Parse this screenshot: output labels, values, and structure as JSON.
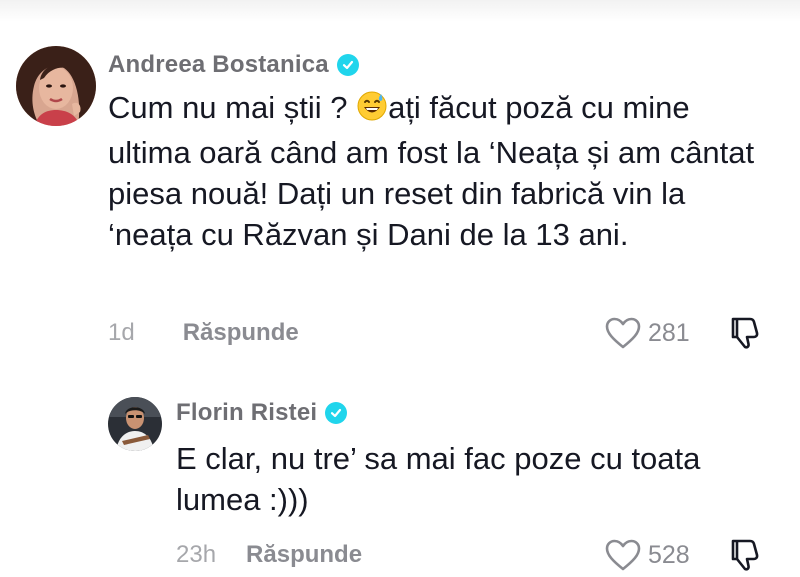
{
  "comments": [
    {
      "username": "Andreea Bostanica",
      "text_before_emoji": "Cum nu mai știi ? ",
      "text_after_emoji": "ați făcut poză cu mine ultima oară când am fost la ‘Neața și am cântat piesa nouă! Dați un reset din fabrică vin la ‘neața cu Răzvan și Dani de la 13 ani.",
      "time": "1d",
      "reply_label": "Răspunde",
      "likes": "281"
    },
    {
      "username": "Florin Ristei",
      "text": "E clar, nu tre’ sa mai fac poze cu toata lumea :)))",
      "time": "23h",
      "reply_label": "Răspunde",
      "likes": "528"
    }
  ],
  "icons": {
    "verified": "verified-badge-icon",
    "emoji": "grinning-sweat-emoji",
    "like": "heart-outline-icon",
    "dislike": "thumbs-down-icon"
  },
  "colors": {
    "verified": "#20d5ec",
    "username": "#6e6e73",
    "meta": "#8a8b91"
  }
}
